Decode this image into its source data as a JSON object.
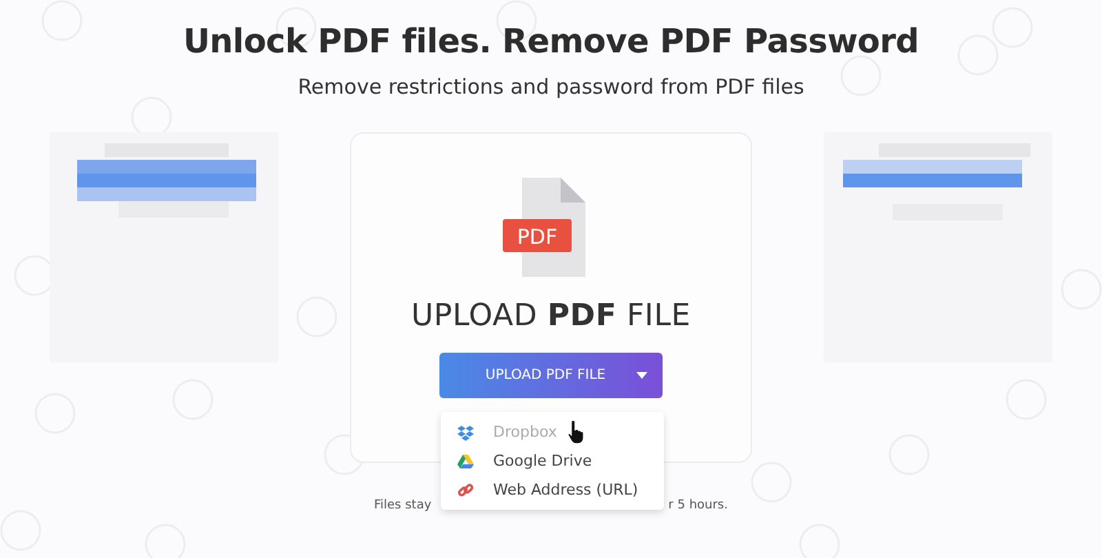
{
  "title": "Unlock PDF files. Remove PDF Password",
  "subtitle": "Remove restrictions and password from PDF files",
  "side_panels": [
    {
      "kind": "picture"
    },
    {
      "kind": "picture"
    }
  ],
  "upload": {
    "badge": "PDF",
    "heading_start": "UPLOAD ",
    "heading_bold": "PDF",
    "heading_end": " FILE",
    "button": "UPLOAD PDF FILE",
    "dropdown_open": true
  },
  "menu": [
    {
      "kind": "dropbox",
      "label": "Dropbox",
      "hovered": true
    },
    {
      "kind": "drive",
      "label": "Google Drive",
      "hovered": false
    },
    {
      "kind": "url",
      "label": "Web Address (URL)",
      "hovered": false
    }
  ],
  "footer": [
    "Files stay",
    "r 5 hours."
  ]
}
